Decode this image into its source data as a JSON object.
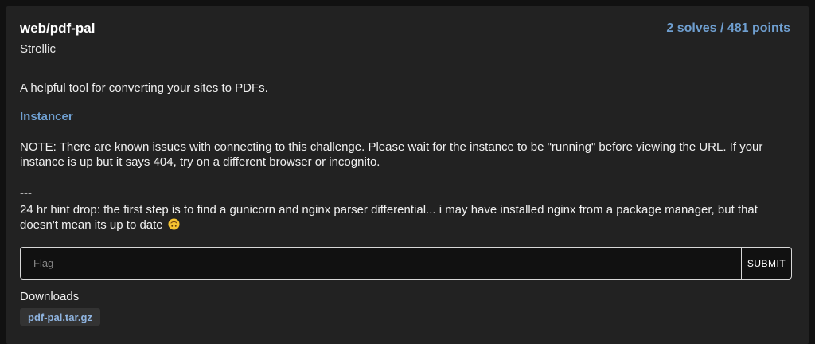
{
  "challenge": {
    "title": "web/pdf-pal",
    "solves_points": "2 solves / 481 points",
    "author": "Strellic",
    "description": "A helpful tool for converting your sites to PDFs.",
    "instancer_label": "Instancer",
    "note": "NOTE: There are known issues with connecting to this challenge. Please wait for the instance to be \"running\" before viewing the URL. If your instance is up but it says 404, try on a different browser or incognito.",
    "separator": "---",
    "hint": "24 hr hint drop: the first step is to find a gunicorn and nginx parser differential... i may have installed nginx from a package manager, but that doesn't mean its up to date",
    "hint_emoji": "upside-down-face-emoji"
  },
  "flag_form": {
    "placeholder": "Flag",
    "value": "",
    "submit_label": "SUBMIT"
  },
  "downloads": {
    "label": "Downloads",
    "files": [
      "pdf-pal.tar.gz"
    ]
  },
  "colors": {
    "background": "#111111",
    "card": "#222222",
    "accent": "#6f9fd0",
    "chip_bg": "#333333",
    "chip_text": "#8fb4e0"
  }
}
